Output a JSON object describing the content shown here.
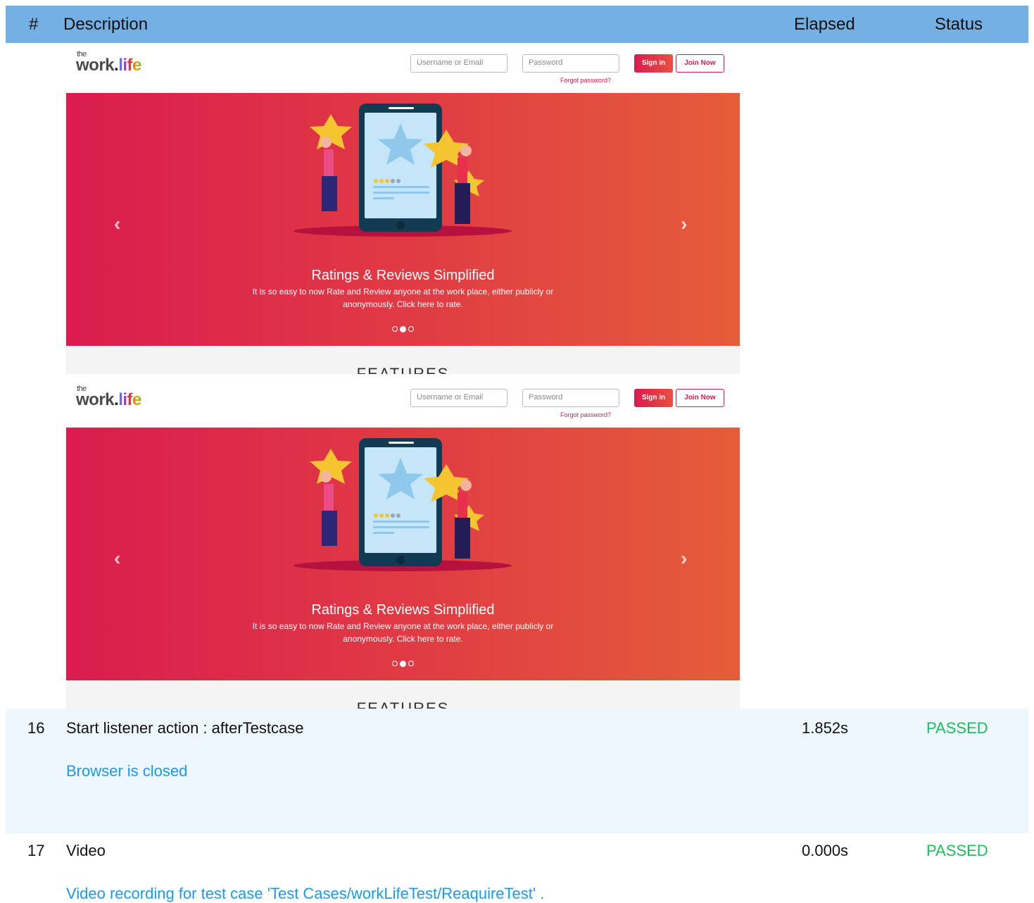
{
  "table": {
    "headers": {
      "num": "#",
      "description": "Description",
      "elapsed": "Elapsed",
      "status": "Status"
    }
  },
  "screenshot": {
    "logo_the": "the",
    "logo_work": "work",
    "logo_dot": ".",
    "logo_life": "life",
    "username_placeholder": "Username or Email",
    "password_placeholder": "Password",
    "forgot_password": "Forgot password?",
    "sign_in": "Sign in",
    "join_now": "Join Now",
    "banner_title": "Ratings & Reviews Simplified",
    "banner_subtitle": "It is so easy to now Rate and Review anyone at the work place, either publicly or anonymously. Click here to rate.",
    "prev_arrow": "‹",
    "next_arrow": "›",
    "features_heading": "FEATURES",
    "carousel_active_index": 1,
    "carousel_count": 3
  },
  "rows": [
    {
      "num": "16",
      "description": "Start listener action : afterTestcase",
      "elapsed": "1.852s",
      "status": "PASSED",
      "note": "Browser is closed"
    },
    {
      "num": "17",
      "description": "Video",
      "elapsed": "0.000s",
      "status": "PASSED",
      "note": "Video recording for test case 'Test Cases/workLifeTest/ReaquireTest' ."
    }
  ],
  "colors": {
    "header_bg": "#74b0e4",
    "passed": "#19c15a",
    "note": "#1a9ae8",
    "row_bg": "#eef6fe",
    "banner_start": "#da1c4e",
    "banner_end": "#e45d3a"
  }
}
